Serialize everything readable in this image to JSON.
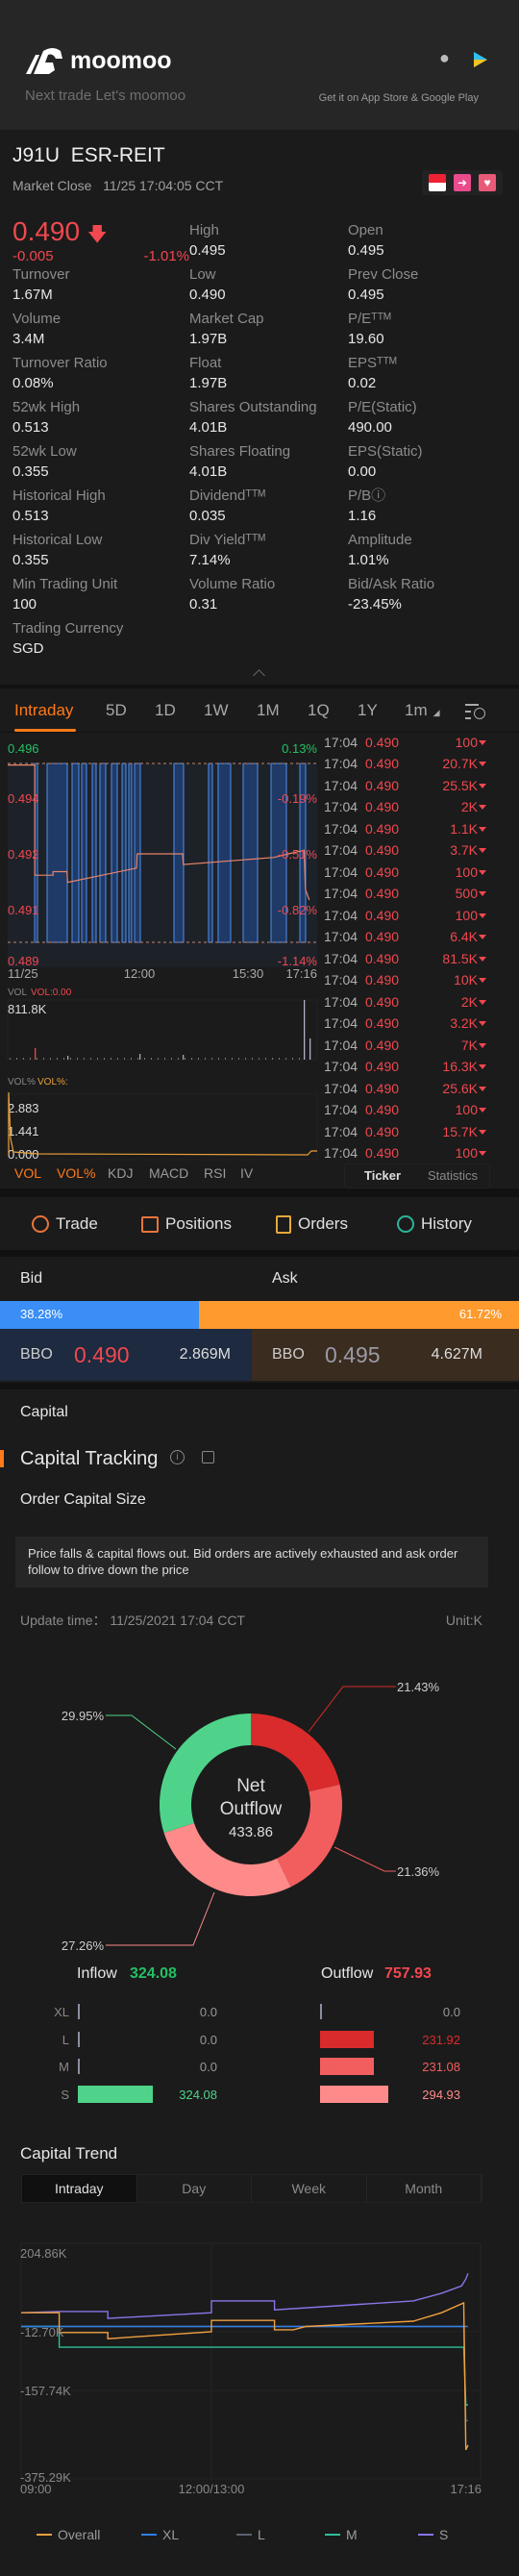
{
  "header": {
    "brand": "moomoo",
    "tagline": "Next trade Let's moomoo",
    "store_text": "Get it on App Store & Google Play",
    "icons": [
      "apple-icon",
      "google-play-icon"
    ]
  },
  "quote": {
    "symbol": "J91U",
    "name": "ESR-REIT",
    "market_status": "Market Close",
    "timestamp": "11/25 17:04:05 CCT",
    "price": "0.490",
    "change": "-0.005",
    "change_pct": "-1.01%",
    "badges": [
      "singapore-flag-icon",
      "lightning-level1-icon",
      "heart-icon"
    ],
    "stats": [
      {
        "label": "High",
        "value": "0.495"
      },
      {
        "label": "Open",
        "value": "0.495"
      },
      {
        "label": "Turnover",
        "value": "1.67M"
      },
      {
        "label": "Low",
        "value": "0.490",
        "color": "red"
      },
      {
        "label": "Prev Close",
        "value": "0.495"
      },
      {
        "label": "Volume",
        "value": "3.4M"
      },
      {
        "label": "Market Cap",
        "value": "1.97B"
      },
      {
        "label": "P/Eᵀᵀᴹ",
        "value": "19.60"
      },
      {
        "label": "Turnover Ratio",
        "value": "0.08%"
      },
      {
        "label": "Float",
        "value": "1.97B"
      },
      {
        "label": "EPSᵀᵀᴹ",
        "value": "0.02"
      },
      {
        "label": "52wk High",
        "value": "0.513"
      },
      {
        "label": "Shares Outstanding",
        "value": "4.01B"
      },
      {
        "label": "P/E(Static)",
        "value": "490.00"
      },
      {
        "label": "52wk Low",
        "value": "0.355"
      },
      {
        "label": "Shares Floating",
        "value": "4.01B"
      },
      {
        "label": "EPS(Static)",
        "value": "0.00"
      },
      {
        "label": "Historical High",
        "value": "0.513"
      },
      {
        "label": "Dividendᵀᵀᴹ",
        "value": "0.035"
      },
      {
        "label": "P/Bⓘ",
        "value": "1.16"
      },
      {
        "label": "Historical Low",
        "value": "0.355"
      },
      {
        "label": "Div Yieldᵀᵀᴹ",
        "value": "7.14%"
      },
      {
        "label": "Amplitude",
        "value": "1.01%"
      },
      {
        "label": "Min Trading Unit",
        "value": "100"
      },
      {
        "label": "Volume Ratio",
        "value": "0.31"
      },
      {
        "label": "Bid/Ask Ratio",
        "value": "-23.45%"
      },
      {
        "label": "Trading Currency",
        "value": "SGD"
      }
    ]
  },
  "chart_tabs": {
    "items": [
      "Intraday",
      "5D",
      "1D",
      "1W",
      "1M",
      "1Q",
      "1Y",
      "1m"
    ],
    "active": "Intraday"
  },
  "intraday": {
    "y_left": [
      "0.496",
      "0.494",
      "0.492",
      "0.491",
      "0.489"
    ],
    "y_right": [
      "0.13%",
      "-0.19%",
      "-0.51%",
      "-0.82%",
      "-1.14%"
    ],
    "x_labels": [
      "11/25",
      "12:00",
      "15:30",
      "17:16"
    ],
    "price_range": [
      0.48936,
      0.49564
    ],
    "prev_close": 0.495,
    "price_points": [
      [
        "09:00",
        0.495
      ],
      [
        "09:37",
        0.495
      ],
      [
        "09:37",
        0.4919
      ],
      [
        "10:02",
        0.4919
      ],
      [
        "10:02",
        0.492
      ],
      [
        "10:21",
        0.492
      ],
      [
        "10:22",
        0.4917
      ],
      [
        "11:56",
        0.4921
      ],
      [
        "11:57",
        0.4925
      ],
      [
        "13:50",
        0.4925
      ],
      [
        "13:51",
        0.4922
      ],
      [
        "16:10",
        0.4924
      ],
      [
        "16:32",
        0.4925
      ],
      [
        "16:56",
        0.4926
      ],
      [
        "16:58",
        0.4915
      ],
      [
        "17:04",
        0.4912
      ]
    ],
    "vol_label": "VOL",
    "vol_value": "VOL:0.00",
    "vol_max": "811.8K",
    "volpct_label": "VOL%",
    "volpct_value": "VOL%:",
    "volpct_ticks": [
      "2.883",
      "1.441",
      "0.000"
    ],
    "indicator_tabs": [
      "VOL",
      "VOL%",
      "KDJ",
      "MACD",
      "RSI",
      "IV"
    ]
  },
  "ticker": {
    "rows": [
      {
        "time": "17:04",
        "price": "0.490",
        "volume": "100"
      },
      {
        "time": "17:04",
        "price": "0.490",
        "volume": "20.7K"
      },
      {
        "time": "17:04",
        "price": "0.490",
        "volume": "25.5K"
      },
      {
        "time": "17:04",
        "price": "0.490",
        "volume": "2K"
      },
      {
        "time": "17:04",
        "price": "0.490",
        "volume": "1.1K"
      },
      {
        "time": "17:04",
        "price": "0.490",
        "volume": "3.7K"
      },
      {
        "time": "17:04",
        "price": "0.490",
        "volume": "100"
      },
      {
        "time": "17:04",
        "price": "0.490",
        "volume": "500"
      },
      {
        "time": "17:04",
        "price": "0.490",
        "volume": "100"
      },
      {
        "time": "17:04",
        "price": "0.490",
        "volume": "6.4K"
      },
      {
        "time": "17:04",
        "price": "0.490",
        "volume": "81.5K"
      },
      {
        "time": "17:04",
        "price": "0.490",
        "volume": "10K"
      },
      {
        "time": "17:04",
        "price": "0.490",
        "volume": "2K"
      },
      {
        "time": "17:04",
        "price": "0.490",
        "volume": "3.2K"
      },
      {
        "time": "17:04",
        "price": "0.490",
        "volume": "7K"
      },
      {
        "time": "17:04",
        "price": "0.490",
        "volume": "16.3K"
      },
      {
        "time": "17:04",
        "price": "0.490",
        "volume": "25.6K"
      },
      {
        "time": "17:04",
        "price": "0.490",
        "volume": "100"
      },
      {
        "time": "17:04",
        "price": "0.490",
        "volume": "15.7K"
      },
      {
        "time": "17:04",
        "price": "0.490",
        "volume": "100"
      }
    ],
    "tabs": [
      "Ticker",
      "Statistics"
    ]
  },
  "actions": [
    "Trade",
    "Positions",
    "Orders",
    "History"
  ],
  "bid_ask": {
    "bid_label": "Bid",
    "ask_label": "Ask",
    "bid_pct": "38.28%",
    "ask_pct": "61.72%",
    "bid_fraction": 0.3828,
    "bbo_label": "BBO",
    "bid_price": "0.490",
    "bid_size": "2.869M",
    "ask_price": "0.495",
    "ask_size": "4.627M",
    "colors": {
      "bid": "#3a8ef6",
      "ask": "#ff9a2e"
    }
  },
  "capital": {
    "section_title": "Capital",
    "tracking_title": "Capital Tracking",
    "subtitle": "Order Capital Size",
    "description": "Price falls & capital flows out. Bid orders are actively exhausted and ask order follow to drive down the price",
    "update_time": "Update time： 11/25/2021 17:04 CCT",
    "unit": "Unit:K",
    "donut": {
      "center_line1": "Net",
      "center_line2": "Outflow",
      "center_value": "433.86",
      "slices": [
        {
          "label": "21.43%",
          "value": 231.92,
          "color": "#d92b2b"
        },
        {
          "label": "21.36%",
          "value": 231.08,
          "color": "#f25d5d"
        },
        {
          "label": "27.26%",
          "value": 294.93,
          "color": "#ff8a8a"
        },
        {
          "label": "29.95%",
          "value": 324.08,
          "color": "#4fd38a"
        }
      ]
    },
    "inflow_label": "Inflow",
    "inflow_total": "324.08",
    "outflow_label": "Outflow",
    "outflow_total": "757.93",
    "rows": [
      {
        "size": "XL",
        "in": 0,
        "in_text": "0.0",
        "out": 0,
        "out_text": "0.0",
        "out_color": "#d92b2b"
      },
      {
        "size": "L",
        "in": 0,
        "in_text": "0.0",
        "out": 231.92,
        "out_text": "231.92",
        "out_color": "#d92b2b"
      },
      {
        "size": "M",
        "in": 0,
        "in_text": "0.0",
        "out": 231.08,
        "out_text": "231.08",
        "out_color": "#f25d5d"
      },
      {
        "size": "S",
        "in": 324.08,
        "in_text": "324.08",
        "out": 294.93,
        "out_text": "294.93",
        "out_color": "#ff8a8a"
      }
    ]
  },
  "trend": {
    "title": "Capital Trend",
    "tabs": [
      "Intraday",
      "Day",
      "Week",
      "Month"
    ],
    "active": "Intraday",
    "y_ticks": [
      "204.86K",
      "-12.70K",
      "-157.74K",
      "-375.29K"
    ],
    "ylim": [
      -375.29,
      204.86
    ],
    "x_labels": [
      "09:00",
      "12:00/13:00",
      "17:16"
    ],
    "series": [
      {
        "name": "Overall",
        "color": "#f0a040",
        "points": [
          [
            "09:00",
            34
          ],
          [
            "09:36",
            34
          ],
          [
            "09:36",
            -15
          ],
          [
            "10:22",
            -15
          ],
          [
            "10:22",
            -30
          ],
          [
            "12:00",
            -13
          ],
          [
            "13:00",
            15
          ],
          [
            "14:00",
            15
          ],
          [
            "14:00",
            -8
          ],
          [
            "14:18",
            -8
          ],
          [
            "14:30",
            0
          ],
          [
            "16:12",
            13
          ],
          [
            "16:39",
            34
          ],
          [
            "17:00",
            58
          ],
          [
            "17:02",
            -304
          ],
          [
            "17:04",
            -292
          ]
        ]
      },
      {
        "name": "XL",
        "color": "#2f7fe8",
        "points": [
          [
            "09:00",
            0
          ],
          [
            "17:04",
            0
          ]
        ]
      },
      {
        "name": "L",
        "color": "#5a6270",
        "points": [
          [
            "09:00",
            0
          ],
          [
            "17:00",
            0
          ],
          [
            "17:02",
            -232
          ],
          [
            "17:04",
            -232
          ]
        ]
      },
      {
        "name": "M",
        "color": "#2fbf9a",
        "points": [
          [
            "09:00",
            0
          ],
          [
            "09:36",
            0
          ],
          [
            "09:36",
            -51
          ],
          [
            "17:00",
            -51
          ],
          [
            "17:02",
            -193
          ],
          [
            "17:04",
            -193
          ]
        ]
      },
      {
        "name": "S",
        "color": "#8a74e8",
        "points": [
          [
            "09:00",
            34
          ],
          [
            "09:36",
            37
          ],
          [
            "10:22",
            37
          ],
          [
            "10:22",
            20
          ],
          [
            "12:00",
            34
          ],
          [
            "13:00",
            63
          ],
          [
            "14:00",
            63
          ],
          [
            "14:00",
            41
          ],
          [
            "16:12",
            63
          ],
          [
            "16:39",
            82
          ],
          [
            "16:58",
            100
          ],
          [
            "17:02",
            117
          ],
          [
            "17:04",
            131
          ]
        ]
      }
    ]
  }
}
